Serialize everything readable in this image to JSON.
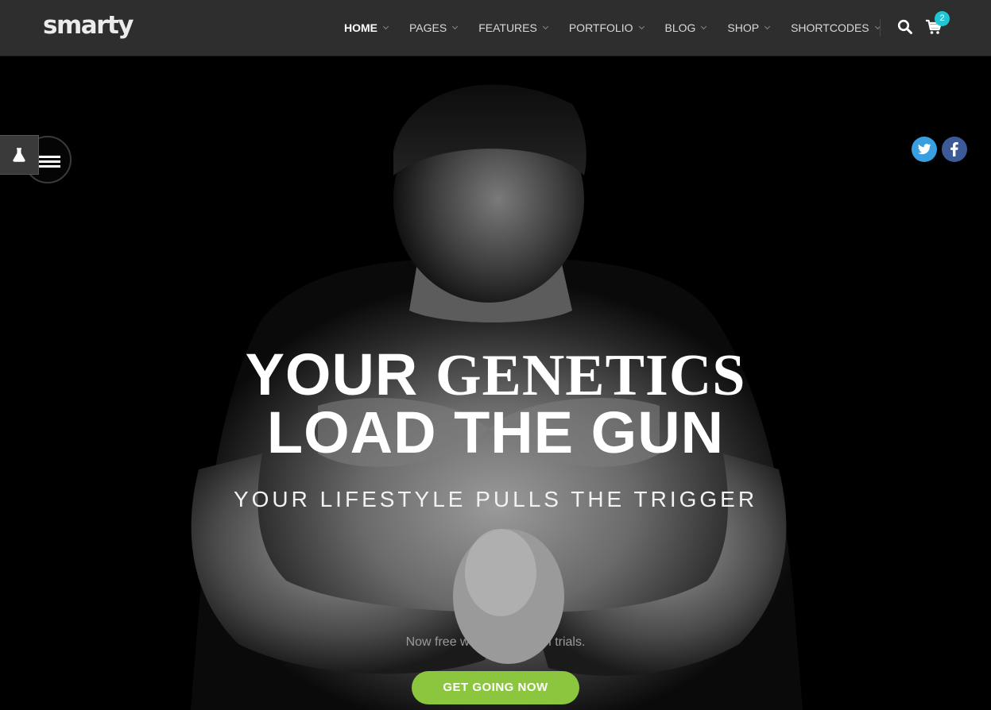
{
  "brand": {
    "logo_text": "smarty"
  },
  "nav": {
    "items": [
      {
        "label": "HOME",
        "active": true
      },
      {
        "label": "PAGES",
        "active": false
      },
      {
        "label": "FEATURES",
        "active": false
      },
      {
        "label": "PORTFOLIO",
        "active": false
      },
      {
        "label": "BLOG",
        "active": false
      },
      {
        "label": "SHOP",
        "active": false
      },
      {
        "label": "SHORTCODES",
        "active": false
      }
    ],
    "cart_count": "2"
  },
  "icons": {
    "search": "search-icon",
    "cart": "cart-icon",
    "menu": "hamburger-icon",
    "flask": "flask-icon",
    "twitter": "twitter-icon",
    "facebook": "facebook-icon"
  },
  "hero": {
    "headline_word1": "YOUR",
    "headline_word2": "GENETICS",
    "headline_line2": "LOAD THE GUN",
    "subheadline": "YOUR LIFESTYLE PULLS THE TRIGGER",
    "tagline": "Now free workout session trials.",
    "cta_label": "GET GOING NOW"
  },
  "colors": {
    "header_bg": "#2e2e2e",
    "accent_green": "#8cc63f",
    "badge_cyan": "#1fc5d4",
    "twitter_blue": "#3a9fe0",
    "facebook_blue": "#3d5a98"
  }
}
